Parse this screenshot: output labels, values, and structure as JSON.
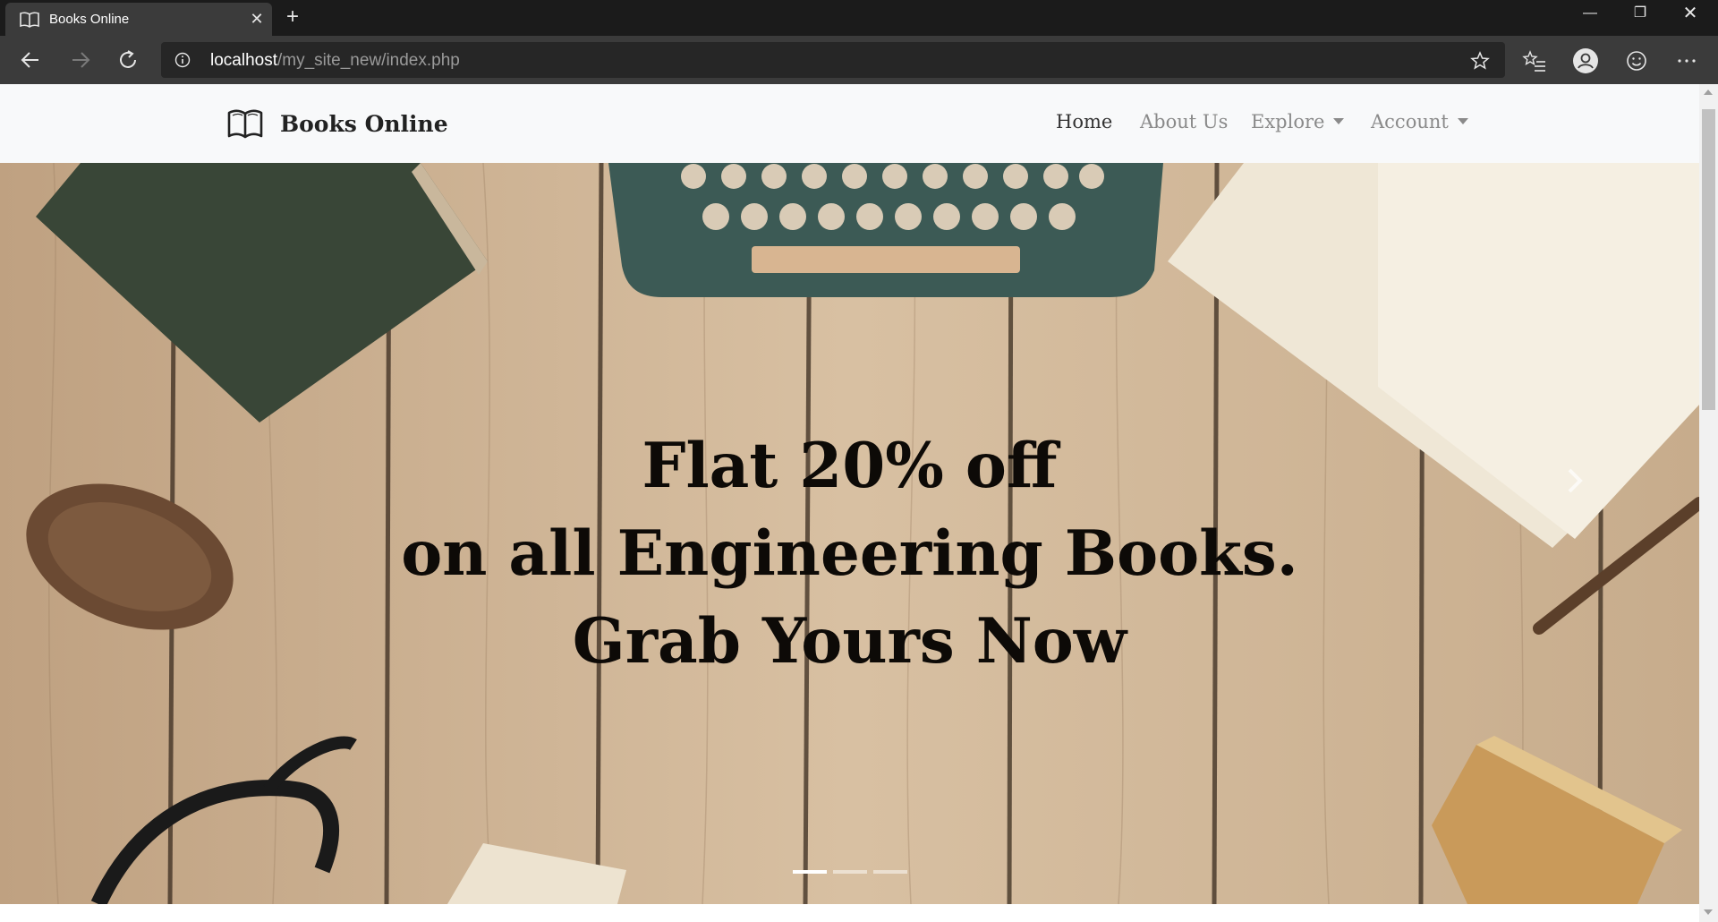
{
  "browser": {
    "tab": {
      "title": "Books Online",
      "icon": "book-open-icon"
    },
    "new_tab_label": "+",
    "window_controls": {
      "minimize": "—",
      "maximize": "❐",
      "close": "✕"
    },
    "tab_close": "✕",
    "url_host": "localhost",
    "url_path": "/my_site_new/index.php",
    "icons": [
      "back-arrow-icon",
      "forward-arrow-icon",
      "reload-icon",
      "info-icon",
      "star-icon",
      "favorites-icon",
      "profile-icon",
      "feedback-icon",
      "more-icon"
    ]
  },
  "site": {
    "brand": {
      "name": "Books Online",
      "icon": "book-open-icon"
    },
    "nav": {
      "home": "Home",
      "about": "About Us",
      "explore": "Explore",
      "account": "Account"
    },
    "hero": {
      "lines": [
        "Flat 20% off",
        "on all Engineering Books.",
        "Grab Yours Now"
      ],
      "active_slide": 1,
      "slide_count": 3
    }
  },
  "colors": {
    "chrome_dark": "#1b1b1b",
    "chrome_mid": "#3b3b3b",
    "navbar_bg": "#f8f9fa",
    "hero_text": "#0d0a07",
    "wood": "#cdb396"
  }
}
